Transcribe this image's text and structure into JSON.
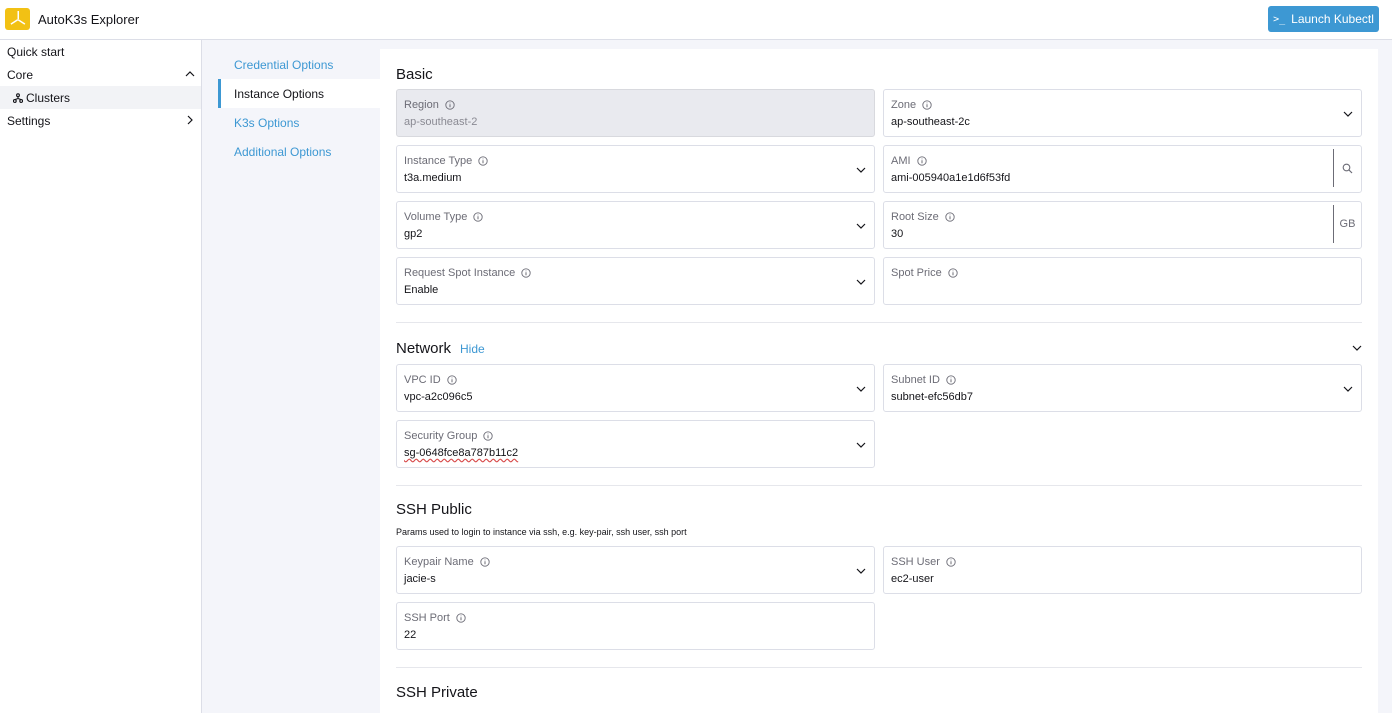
{
  "app": {
    "title": "AutoK3s Explorer"
  },
  "header": {
    "launch_label": "Launch Kubectl",
    "launch_icon": ">_"
  },
  "leftnav": {
    "items": [
      {
        "label": "Quick start"
      },
      {
        "label": "Core"
      },
      {
        "label": "Clusters"
      },
      {
        "label": "Settings"
      }
    ]
  },
  "options_nav": {
    "items": [
      {
        "label": "Credential Options"
      },
      {
        "label": "Instance Options"
      },
      {
        "label": "K3s Options"
      },
      {
        "label": "Additional Options"
      }
    ]
  },
  "basic": {
    "title": "Basic",
    "region": {
      "label": "Region",
      "value": "ap-southeast-2"
    },
    "zone": {
      "label": "Zone",
      "value": "ap-southeast-2c"
    },
    "instance_type": {
      "label": "Instance Type",
      "value": "t3a.medium"
    },
    "ami": {
      "label": "AMI",
      "value": "ami-005940a1e1d6f53fd"
    },
    "volume_type": {
      "label": "Volume Type",
      "value": "gp2"
    },
    "root_size": {
      "label": "Root Size",
      "value": "30",
      "unit": "GB"
    },
    "spot_instance": {
      "label": "Request Spot Instance",
      "value": "Enable"
    },
    "spot_price": {
      "label": "Spot Price",
      "value": ""
    }
  },
  "network": {
    "title": "Network",
    "toggle_label": "Hide",
    "vpc_id": {
      "label": "VPC ID",
      "value": "vpc-a2c096c5"
    },
    "subnet_id": {
      "label": "Subnet ID",
      "value": "subnet-efc56db7"
    },
    "security_group": {
      "label": "Security Group",
      "value": "sg-0648fce8a787b11c2"
    }
  },
  "ssh_public": {
    "title": "SSH Public",
    "description": "Params used to login to instance via ssh, e.g. key-pair, ssh user, ssh port",
    "keypair": {
      "label": "Keypair Name",
      "value": "jacie-s"
    },
    "ssh_user": {
      "label": "SSH User",
      "value": "ec2-user"
    },
    "ssh_port": {
      "label": "SSH Port",
      "value": "22"
    }
  },
  "ssh_private": {
    "title": "SSH Private"
  },
  "colors": {
    "accent": "#3d98d3",
    "logo": "#f2c114"
  }
}
